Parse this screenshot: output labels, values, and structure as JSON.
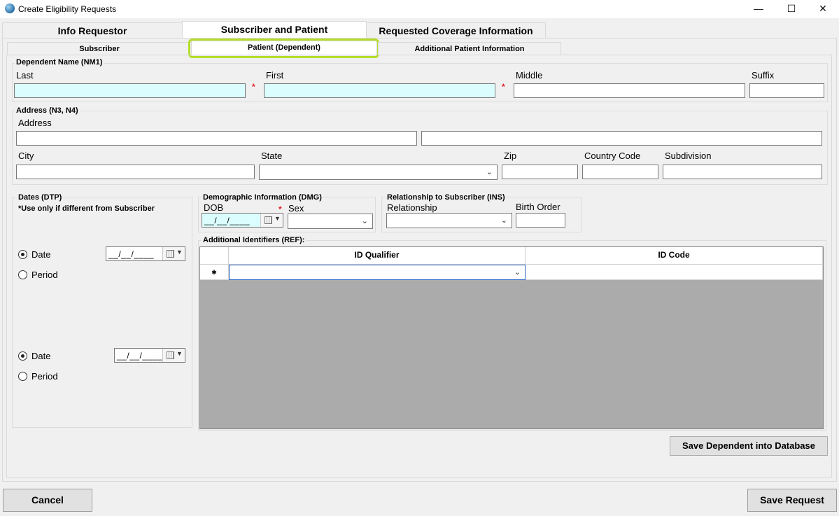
{
  "window": {
    "title": "Create Eligibility Requests",
    "minimize": "—",
    "maximize": "☐",
    "close": "✕"
  },
  "tabs": [
    {
      "label": "Info Requestor"
    },
    {
      "label": "Subscriber and Patient"
    },
    {
      "label": "Requested Coverage Information"
    }
  ],
  "subtabs": [
    {
      "label": "Subscriber"
    },
    {
      "label": "Patient (Dependent)"
    },
    {
      "label": "Additional Patient Information"
    }
  ],
  "dependent_name": {
    "title": "Dependent Name (NM1)",
    "last_label": "Last",
    "first_label": "First",
    "middle_label": "Middle",
    "suffix_label": "Suffix",
    "required_mark": "*"
  },
  "address": {
    "title": "Address (N3, N4)",
    "address_label": "Address",
    "city_label": "City",
    "state_label": "State",
    "zip_label": "Zip",
    "country_label": "Country Code",
    "subdivision_label": "Subdivision"
  },
  "dates": {
    "title": "Dates (DTP)",
    "note": "*Use only if different from Subscriber",
    "date_label": "Date",
    "period_label": "Period",
    "date_placeholder": "__/__/____"
  },
  "demographic": {
    "title": "Demographic Information (DMG)",
    "dob_label": "DOB",
    "sex_label": "Sex",
    "dob_placeholder": "__/__/____",
    "required_mark": "*"
  },
  "relationship": {
    "title": "Relationship to Subscriber (INS)",
    "relationship_label": "Relationship",
    "birth_order_label": "Birth Order"
  },
  "identifiers": {
    "title": "Additional Identifiers (REF):",
    "columns": [
      "ID Qualifier",
      "ID Code"
    ],
    "new_row_marker": "✱"
  },
  "buttons": {
    "save_dependent": "Save Dependent into Database",
    "cancel": "Cancel",
    "save_request": "Save Request"
  },
  "colors": {
    "required_field_bg": "#dcfdfd",
    "highlight_outline": "#b4dd2a",
    "required_star": "#e0202a"
  }
}
